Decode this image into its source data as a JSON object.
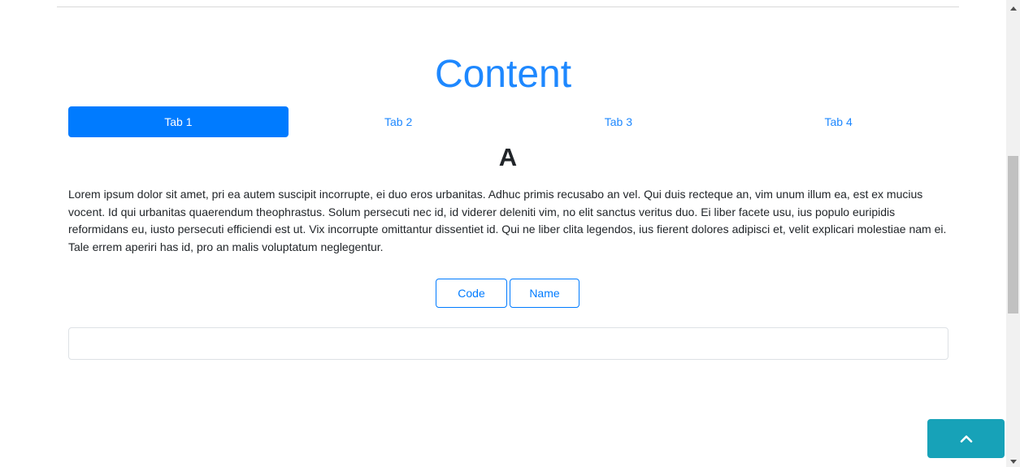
{
  "main": {
    "title": "Content",
    "tabs": [
      {
        "label": "Tab 1",
        "active": true
      },
      {
        "label": "Tab 2",
        "active": false
      },
      {
        "label": "Tab 3",
        "active": false
      },
      {
        "label": "Tab 4",
        "active": false
      }
    ],
    "section_heading": "A",
    "body_text": "Lorem ipsum dolor sit amet, pri ea autem suscipit incorrupte, ei duo eros urbanitas. Adhuc primis recusabo an vel. Qui duis recteque an, vim unum illum ea, est ex mucius vocent. Id qui urbanitas quaerendum theophrastus. Solum persecuti nec id, id viderer deleniti vim, no elit sanctus veritus duo. Ei liber facete usu, ius populo euripidis reformidans eu, iusto persecuti efficiendi est ut. Vix incorrupte omittantur dissentiet id. Qui ne liber clita legendos, ius fierent dolores adipisci et, velit explicari molestiae nam ei. Tale errem aperiri has id, pro an malis voluptatum neglegentur.",
    "buttons": {
      "code": "Code",
      "name": "Name"
    },
    "input": {
      "value": "",
      "placeholder": ""
    }
  },
  "icons": {
    "scroll_top": "chevron-up-icon",
    "scroll_up": "triangle-up-icon",
    "scroll_down": "triangle-down-icon"
  },
  "colors": {
    "accent": "#007bff",
    "title": "#1e88ff",
    "scroll_top_bg": "#17a2b8",
    "text": "#212529"
  }
}
